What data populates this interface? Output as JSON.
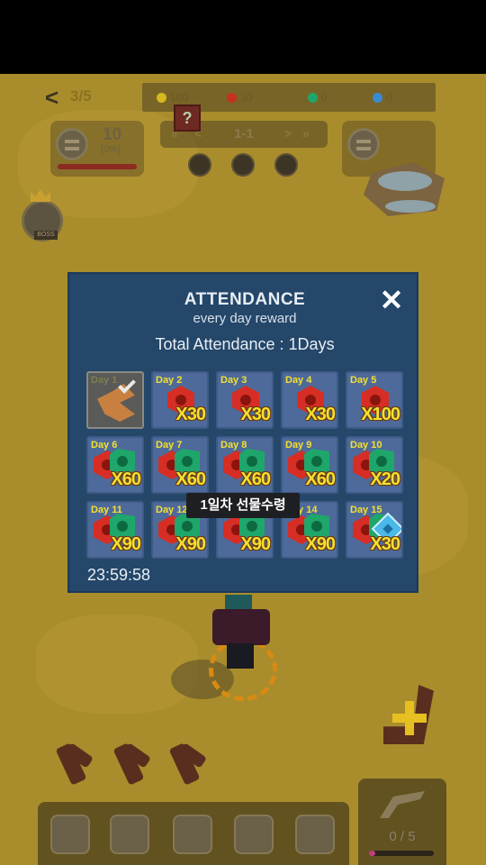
{
  "hud": {
    "stage_progress": "3/5",
    "resources": [
      {
        "name": "gold",
        "value": "100",
        "color": "#d6b820"
      },
      {
        "name": "red-gem",
        "value": "30",
        "color": "#c83020"
      },
      {
        "name": "green-gem",
        "value": "0",
        "color": "#1fa66a"
      },
      {
        "name": "blue-gem",
        "value": "0",
        "color": "#3a8ad0"
      }
    ],
    "player": {
      "level": "10",
      "percent": "[0%]"
    },
    "stage": {
      "label": "1-1",
      "prev_fast": "«",
      "prev": "<",
      "next": ">",
      "next_fast": "»"
    },
    "mystery_box": "?",
    "boss_tag": "BOSS"
  },
  "modal": {
    "title": "ATTENDANCE",
    "subtitle": "every day reward",
    "total": "Total Attendance : 1Days",
    "close": "✕",
    "timer": "23:59:58",
    "tooltip": "1일차 선물수령",
    "days": [
      {
        "day": "Day 1",
        "qty": "",
        "claimed": true
      },
      {
        "day": "Day 2",
        "qty": "X30",
        "reward": "red"
      },
      {
        "day": "Day 3",
        "qty": "X30",
        "reward": "red"
      },
      {
        "day": "Day 4",
        "qty": "X30",
        "reward": "red"
      },
      {
        "day": "Day 5",
        "qty": "X100",
        "reward": "red"
      },
      {
        "day": "Day 6",
        "qty": "X60",
        "reward": "red-green"
      },
      {
        "day": "Day 7",
        "qty": "X60",
        "reward": "red-green"
      },
      {
        "day": "Day 8",
        "qty": "X60",
        "reward": "red-green"
      },
      {
        "day": "Day 9",
        "qty": "X60",
        "reward": "red-green"
      },
      {
        "day": "Day 10",
        "qty": "X20",
        "reward": "red-green"
      },
      {
        "day": "Day 11",
        "qty": "X90",
        "reward": "red-green"
      },
      {
        "day": "Day 12",
        "qty": "X90",
        "reward": "red-green"
      },
      {
        "day": "Day 13",
        "qty": "X90",
        "reward": "red-green"
      },
      {
        "day": "Day 14",
        "qty": "X90",
        "reward": "red-green"
      },
      {
        "day": "Day 15",
        "qty": "X30",
        "reward": "red-green-blue"
      }
    ]
  },
  "weapon_slot": {
    "count": "0 / 5",
    "fill_fraction": 0.1
  },
  "colors": {
    "modal_bg": "#24476a",
    "cell_bg": "#4e6a9a",
    "accent_yellow": "#f3e030",
    "sand": "#a98d2c"
  }
}
